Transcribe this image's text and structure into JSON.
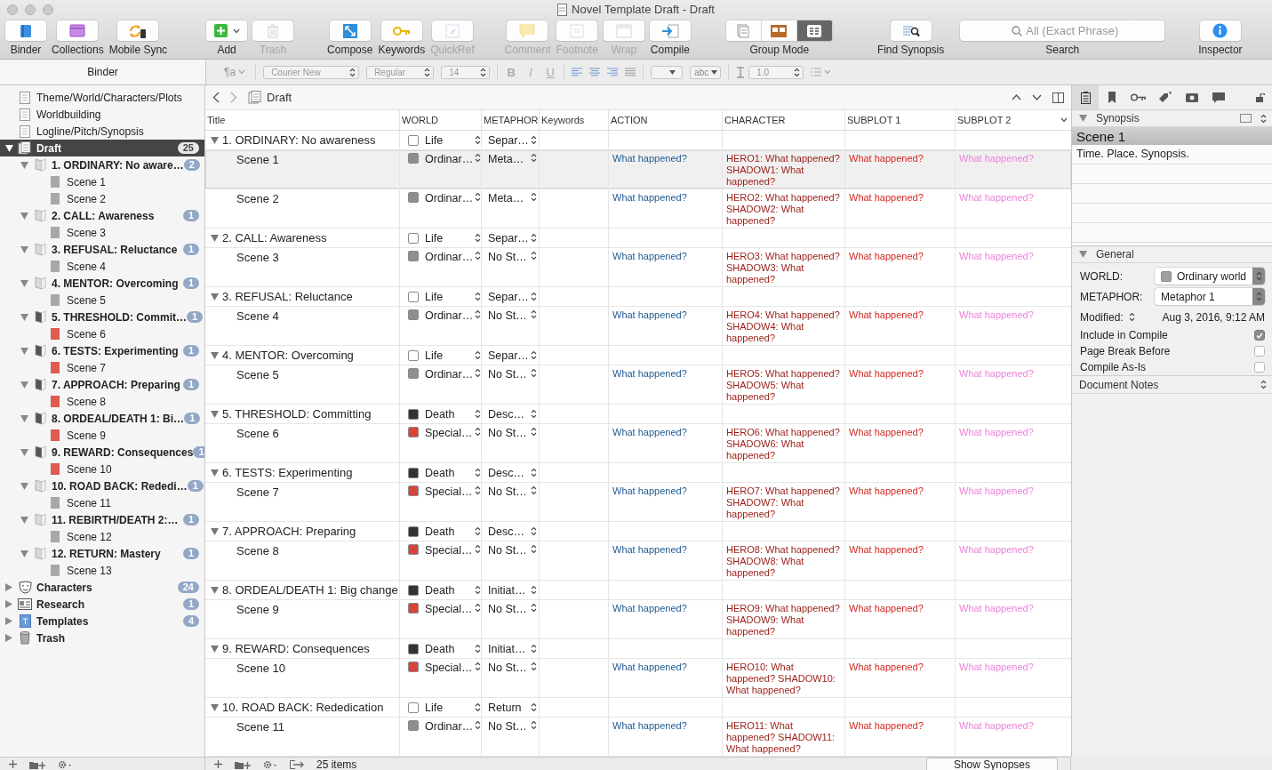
{
  "window": {
    "title": "Novel Template Draft - Draft"
  },
  "toolbar": {
    "groups": [
      [
        {
          "kind": "button",
          "label": "Binder",
          "disabled": false
        },
        {
          "kind": "button",
          "label": "Collections",
          "disabled": false
        },
        {
          "kind": "button",
          "label": "Mobile Sync",
          "disabled": false
        }
      ],
      [
        {
          "kind": "menu-button",
          "label": "Add",
          "disabled": false
        },
        {
          "kind": "button",
          "label": "Trash",
          "disabled": true
        }
      ],
      [
        {
          "kind": "button",
          "label": "Compose",
          "disabled": false
        },
        {
          "kind": "button",
          "label": "Keywords",
          "disabled": false
        },
        {
          "kind": "button",
          "label": "QuickRef",
          "disabled": true
        }
      ],
      [
        {
          "kind": "button",
          "label": "Comment",
          "disabled": true
        },
        {
          "kind": "button",
          "label": "Footnote",
          "disabled": true
        },
        {
          "kind": "button",
          "label": "Wrap",
          "disabled": true
        },
        {
          "kind": "button",
          "label": "Compile",
          "disabled": false
        }
      ],
      [
        {
          "kind": "segmented",
          "label": "Group Mode",
          "segments": [
            {
              "selected": false
            },
            {
              "selected": false
            },
            {
              "selected": true
            }
          ]
        }
      ],
      [
        {
          "kind": "button",
          "label": "Find Synopsis",
          "disabled": false
        }
      ],
      [
        {
          "kind": "search",
          "label": "Search",
          "placeholder": "All (Exact Phrase)"
        }
      ],
      [
        {
          "kind": "button",
          "label": "Inspector",
          "disabled": false
        }
      ]
    ]
  },
  "binder": {
    "header": "Binder",
    "items": [
      {
        "label": "Theme/World/Characters/Plots",
        "kind": "document",
        "selected": false
      },
      {
        "label": "Worldbuilding",
        "kind": "document",
        "selected": false
      },
      {
        "label": "Logline/Pitch/Synopsis",
        "kind": "document",
        "selected": false
      },
      {
        "label": "Draft",
        "kind": "draft",
        "count": "25",
        "expanded": true,
        "selected": true,
        "children": [
          {
            "label": "1. ORDINARY: No aware…",
            "kind": "folder",
            "color": "#d9d9d9",
            "count": "2",
            "expanded": true,
            "selected": false,
            "children": [
              {
                "label": "Scene 1",
                "kind": "scene",
                "color": "#a8a8a8",
                "selected": false
              },
              {
                "label": "Scene 2",
                "kind": "scene",
                "color": "#a8a8a8",
                "selected": false
              }
            ]
          },
          {
            "label": "2. CALL: Awareness",
            "kind": "folder",
            "color": "#d9d9d9",
            "count": "1",
            "expanded": true,
            "selected": false,
            "children": [
              {
                "label": "Scene 3",
                "kind": "scene",
                "color": "#a8a8a8",
                "selected": false
              }
            ]
          },
          {
            "label": "3. REFUSAL: Reluctance",
            "kind": "folder",
            "color": "#d9d9d9",
            "count": "1",
            "expanded": true,
            "selected": false,
            "children": [
              {
                "label": "Scene 4",
                "kind": "scene",
                "color": "#a8a8a8",
                "selected": false
              }
            ]
          },
          {
            "label": "4. MENTOR: Overcoming",
            "kind": "folder",
            "color": "#d9d9d9",
            "count": "1",
            "expanded": true,
            "selected": false,
            "children": [
              {
                "label": "Scene 5",
                "kind": "scene",
                "color": "#a8a8a8",
                "selected": false
              }
            ]
          },
          {
            "label": "5. THRESHOLD: Commit…",
            "kind": "folder",
            "color": "#555555",
            "count": "1",
            "expanded": true,
            "selected": false,
            "children": [
              {
                "label": "Scene 6",
                "kind": "scene",
                "color": "#e05a50",
                "selected": false
              }
            ]
          },
          {
            "label": "6. TESTS: Experimenting",
            "kind": "folder",
            "color": "#555555",
            "count": "1",
            "expanded": true,
            "selected": false,
            "children": [
              {
                "label": "Scene 7",
                "kind": "scene",
                "color": "#e05a50",
                "selected": false
              }
            ]
          },
          {
            "label": "7. APPROACH: Preparing",
            "kind": "folder",
            "color": "#555555",
            "count": "1",
            "expanded": true,
            "selected": false,
            "children": [
              {
                "label": "Scene 8",
                "kind": "scene",
                "color": "#e05a50",
                "selected": false
              }
            ]
          },
          {
            "label": "8. ORDEAL/DEATH 1: Bi…",
            "kind": "folder",
            "color": "#555555",
            "count": "1",
            "expanded": true,
            "selected": false,
            "children": [
              {
                "label": "Scene 9",
                "kind": "scene",
                "color": "#e05a50",
                "selected": false
              }
            ]
          },
          {
            "label": "9. REWARD: Consequences",
            "kind": "folder",
            "color": "#555555",
            "count": "1",
            "expanded": true,
            "selected": false,
            "children": [
              {
                "label": "Scene 10",
                "kind": "scene",
                "color": "#e05a50",
                "selected": false
              }
            ]
          },
          {
            "label": "10. ROAD BACK: Rededi…",
            "kind": "folder",
            "color": "#d9d9d9",
            "count": "1",
            "expanded": true,
            "selected": false,
            "children": [
              {
                "label": "Scene 11",
                "kind": "scene",
                "color": "#a8a8a8",
                "selected": false
              }
            ]
          },
          {
            "label": "11. REBIRTH/DEATH 2:…",
            "kind": "folder",
            "color": "#d9d9d9",
            "count": "1",
            "expanded": true,
            "selected": false,
            "children": [
              {
                "label": "Scene 12",
                "kind": "scene",
                "color": "#a8a8a8",
                "selected": false
              }
            ]
          },
          {
            "label": "12. RETURN: Mastery",
            "kind": "folder",
            "color": "#d9d9d9",
            "count": "1",
            "expanded": true,
            "selected": false,
            "children": [
              {
                "label": "Scene 13",
                "kind": "scene",
                "color": "#a8a8a8",
                "selected": false
              }
            ]
          }
        ]
      },
      {
        "label": "Characters",
        "kind": "characters",
        "count": "24",
        "expanded": false,
        "selected": false
      },
      {
        "label": "Research",
        "kind": "research",
        "count": "1",
        "expanded": false,
        "selected": false
      },
      {
        "label": "Templates",
        "kind": "templates",
        "count": "4",
        "expanded": false,
        "selected": false
      },
      {
        "label": "Trash",
        "kind": "trash",
        "expanded": false,
        "selected": false
      }
    ]
  },
  "format_bar": {
    "style": "¶a",
    "font": "Courier New",
    "weight": "Regular",
    "size": "14",
    "bold": "B",
    "italic": "I",
    "underline": "U",
    "highlight": "abc",
    "spacing": "1.0"
  },
  "outline": {
    "title": "Draft",
    "columns": [
      "Title",
      "WORLD",
      "METAPHOR",
      "Keywords",
      "ACTION",
      "CHARACTER",
      "SUBPLOT 1",
      "SUBPLOT 2"
    ],
    "rows": [
      {
        "title": "1. ORDINARY: No awareness",
        "world": "Life",
        "color": "#ffffff",
        "metaphor": "Separ…",
        "expanded": true,
        "selected": false,
        "children": [
          {
            "title": "Scene 1",
            "world": "Ordinar…",
            "color": "#8e8e8e",
            "metaphor": "Meta…",
            "action": "What happened?",
            "character": "HERO1: What happened? SHADOW1: What happened?",
            "subplot_1": "What happened?",
            "subplot_2": "What happened?",
            "selected": true
          },
          {
            "title": "Scene 2",
            "world": "Ordinar…",
            "color": "#8e8e8e",
            "metaphor": "Meta…",
            "action": "What happened?",
            "character": "HERO2: What happened? SHADOW2: What happened?",
            "subplot_1": "What happened?",
            "subplot_2": "What happened?",
            "selected": false
          }
        ]
      },
      {
        "title": "2. CALL: Awareness",
        "world": "Life",
        "color": "#ffffff",
        "metaphor": "Separ…",
        "expanded": true,
        "selected": false,
        "children": [
          {
            "title": "Scene 3",
            "world": "Ordinar…",
            "color": "#8e8e8e",
            "metaphor": "No St…",
            "action": "What happened?",
            "character": "HERO3: What happened? SHADOW3: What happened?",
            "subplot_1": "What happened?",
            "subplot_2": "What happened?",
            "selected": false
          }
        ]
      },
      {
        "title": "3. REFUSAL: Reluctance",
        "world": "Life",
        "color": "#ffffff",
        "metaphor": "Separ…",
        "expanded": true,
        "selected": false,
        "children": [
          {
            "title": "Scene 4",
            "world": "Ordinar…",
            "color": "#8e8e8e",
            "metaphor": "No St…",
            "action": "What happened?",
            "character": "HERO4: What happened? SHADOW4: What happened?",
            "subplot_1": "What happened?",
            "subplot_2": "What happened?",
            "selected": false
          }
        ]
      },
      {
        "title": "4. MENTOR: Overcoming",
        "world": "Life",
        "color": "#ffffff",
        "metaphor": "Separ…",
        "expanded": true,
        "selected": false,
        "children": [
          {
            "title": "Scene 5",
            "world": "Ordinar…",
            "color": "#8e8e8e",
            "metaphor": "No St…",
            "action": "What happened?",
            "character": "HERO5: What happened? SHADOW5: What happened?",
            "subplot_1": "What happened?",
            "subplot_2": "What happened?",
            "selected": false
          }
        ]
      },
      {
        "title": "5. THRESHOLD: Committing",
        "world": "Death",
        "color": "#333333",
        "metaphor": "Desc…",
        "expanded": true,
        "selected": false,
        "children": [
          {
            "title": "Scene 6",
            "world": "Special…",
            "color": "#d9443a",
            "metaphor": "No St…",
            "action": "What happened?",
            "character": "HERO6: What happened? SHADOW6: What happened?",
            "subplot_1": "What happened?",
            "subplot_2": "What happened?",
            "selected": false
          }
        ]
      },
      {
        "title": "6. TESTS: Experimenting",
        "world": "Death",
        "color": "#333333",
        "metaphor": "Desc…",
        "expanded": true,
        "selected": false,
        "children": [
          {
            "title": "Scene 7",
            "world": "Special…",
            "color": "#d9443a",
            "metaphor": "No St…",
            "action": "What happened?",
            "character": "HERO7: What happened? SHADOW7: What happened?",
            "subplot_1": "What happened?",
            "subplot_2": "What happened?",
            "selected": false
          }
        ]
      },
      {
        "title": "7. APPROACH: Preparing",
        "world": "Death",
        "color": "#333333",
        "metaphor": "Desc…",
        "expanded": true,
        "selected": false,
        "children": [
          {
            "title": "Scene 8",
            "world": "Special…",
            "color": "#d9443a",
            "metaphor": "No St…",
            "action": "What happened?",
            "character": "HERO8: What happened? SHADOW8: What happened?",
            "subplot_1": "What happened?",
            "subplot_2": "What happened?",
            "selected": false
          }
        ]
      },
      {
        "title": "8. ORDEAL/DEATH 1: Big change",
        "world": "Death",
        "color": "#333333",
        "metaphor": "Initiat…",
        "expanded": true,
        "selected": false,
        "children": [
          {
            "title": "Scene 9",
            "world": "Special…",
            "color": "#d9443a",
            "metaphor": "No St…",
            "action": "What happened?",
            "character": "HERO9: What happened? SHADOW9: What happened?",
            "subplot_1": "What happened?",
            "subplot_2": "What happened?",
            "selected": false
          }
        ]
      },
      {
        "title": "9. REWARD: Consequences",
        "world": "Death",
        "color": "#333333",
        "metaphor": "Initiat…",
        "expanded": true,
        "selected": false,
        "children": [
          {
            "title": "Scene 10",
            "world": "Special…",
            "color": "#d9443a",
            "metaphor": "No St…",
            "action": "What happened?",
            "character": "HERO10: What happened? SHADOW10: What happened?",
            "subplot_1": "What happened?",
            "subplot_2": "What happened?",
            "selected": false
          }
        ]
      },
      {
        "title": "10. ROAD BACK: Rededication",
        "world": "Life",
        "color": "#ffffff",
        "metaphor": "Return",
        "expanded": true,
        "selected": false,
        "children": [
          {
            "title": "Scene 11",
            "world": "Ordinar…",
            "color": "#8e8e8e",
            "metaphor": "No St…",
            "action": "What happened?",
            "character": "HERO11: What happened? SHADOW11: What happened?",
            "subplot_1": "What happened?",
            "subplot_2": "What happened?",
            "selected": false
          }
        ]
      }
    ],
    "item_count": "25 items",
    "show_synopses": "Show Synopses"
  },
  "inspector": {
    "tabs": [
      {
        "selected": true
      },
      {
        "selected": false
      },
      {
        "selected": false
      },
      {
        "selected": false
      },
      {
        "selected": false
      },
      {
        "selected": false
      }
    ],
    "synopsis": {
      "header": "Synopsis",
      "title": "Scene 1",
      "text": "Time. Place. Synopsis."
    },
    "general": {
      "header": "General",
      "world_label": "WORLD:",
      "world_value": "Ordinary world",
      "metaphor_label": "METAPHOR:",
      "metaphor_value": "Metaphor 1",
      "modified_label": "Modified:",
      "modified_value": "Aug 3, 2016, 9:12 AM",
      "options": [
        {
          "label": "Include in Compile",
          "checked": true
        },
        {
          "label": "Page Break Before",
          "checked": false
        },
        {
          "label": "Compile As-Is",
          "checked": false
        }
      ]
    },
    "notes": {
      "header": "Document Notes"
    }
  }
}
